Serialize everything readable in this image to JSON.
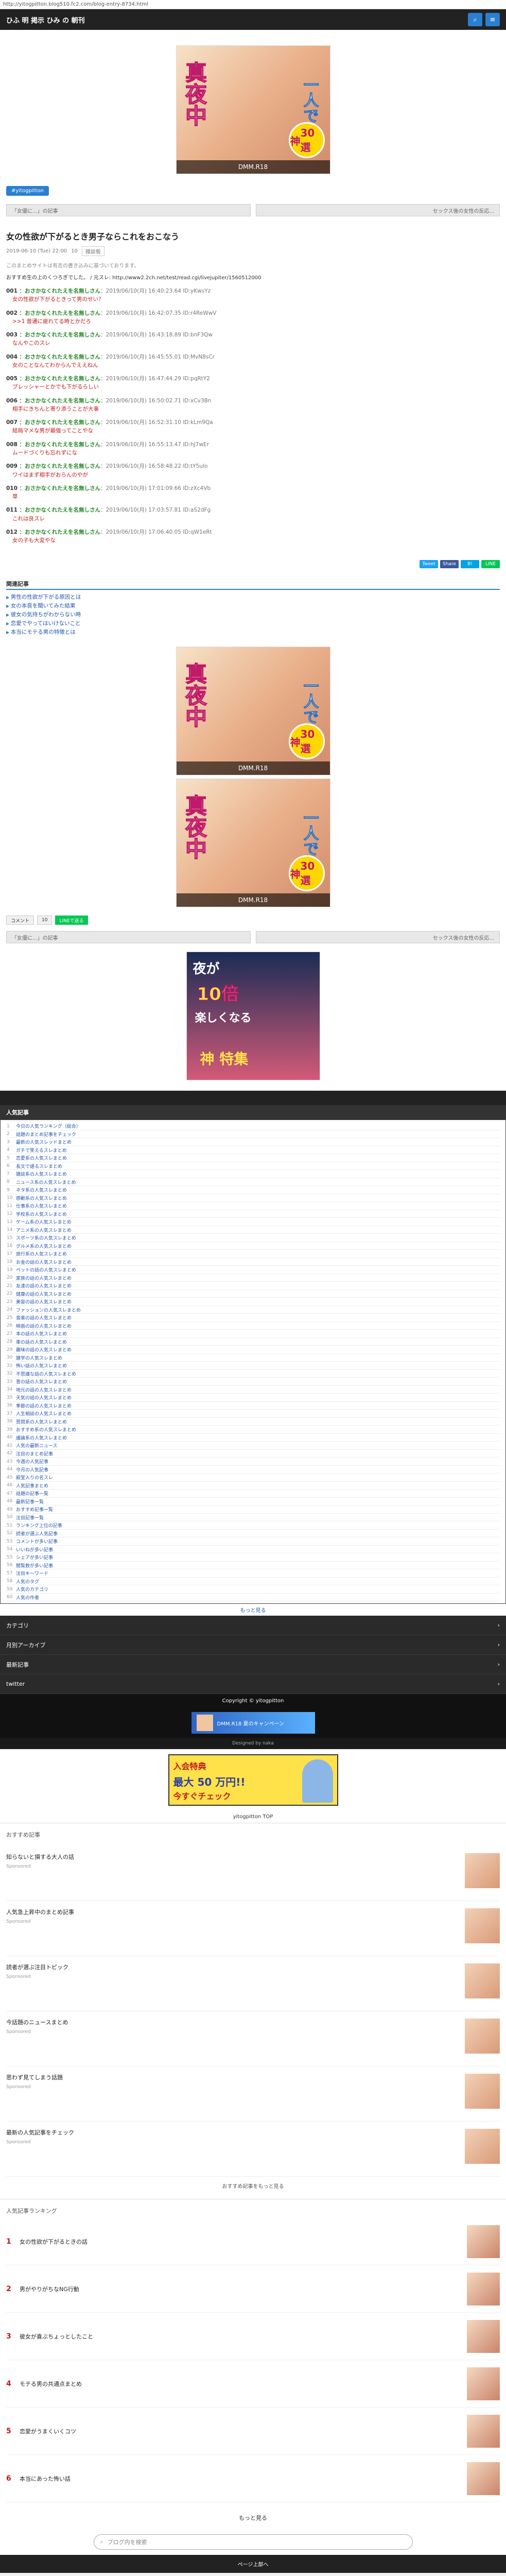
{
  "browser": {
    "url": "http://yitogpitton.blog510.fc2.com/blog-entry-8734.html"
  },
  "header": {
    "site_name": "ひふ 明 掲示  ひみ の 朝刊",
    "buttons": [
      "search-icon",
      "menu-icon"
    ]
  },
  "poster": {
    "line1": "真夜中",
    "line2": "一人で",
    "line3": "神",
    "badge": "30選",
    "brand": "DMM.R18"
  },
  "tag": "#yitogpitton",
  "nav": {
    "prev": "「女優に...」の記事",
    "next": "セックス後の女性の反応..."
  },
  "article": {
    "title": "女の性欲が下がるとき男子ならこれをおこなう",
    "date": "2019-06-10 (Tue) 22:00",
    "comments_count": "10",
    "category": "雑談板",
    "subnote": "このまとめサイトは有志の書き込みに基づいております。",
    "source": "おすすめ生の上のくつろぎでした。 / 元スレ: http://www2.2ch.net/test/read.cgi/livejupiter/1560512000",
    "posts": [
      {
        "num": "001",
        "name": "：おさかなくれたえを名無しさん",
        "date": "：2019/06/10(月) 16:40:23.64 ID:yKwsYz",
        "body": "女の性欲が下がるときって男のせい？"
      },
      {
        "num": "002",
        "name": "：おさかなくれたえを名無しさん",
        "date": "：2019/06/10(月) 16:42:07.35 ID:r4ReWwV",
        "body": ">>1 普通に疲れてる時とかだろ"
      },
      {
        "num": "003",
        "name": "：おさかなくれたえを名無しさん",
        "date": "：2019/06/10(月) 16:43:18.89 ID:bnF3Qw",
        "body": "なんやこのスレ"
      },
      {
        "num": "004",
        "name": "：おさかなくれたえを名無しさん",
        "date": "：2019/06/10(月) 16:45:55.01 ID:MvN8sCr",
        "body": "女のことなんてわからんでええねん"
      },
      {
        "num": "005",
        "name": "：おさかなくれたえを名無しさん",
        "date": "：2019/06/10(月) 16:47:44.29 ID:pqRtY2",
        "body": "プレッシャーとかでも下がるらしい"
      },
      {
        "num": "006",
        "name": "：おさかなくれたえを名無しさん",
        "date": "：2019/06/10(月) 16:50:02.71 ID:xCv3Bn",
        "body": "相手にきちんと寄り添うことが大事"
      },
      {
        "num": "007",
        "name": "：おさかなくれたえを名無しさん",
        "date": "：2019/06/10(月) 16:52:31.10 ID:kLm9Qa",
        "body": "結局マメな男が最強ってことやな"
      },
      {
        "num": "008",
        "name": "：おさかなくれたえを名無しさん",
        "date": "：2019/06/10(月) 16:55:13.47 ID:hJ7wEr",
        "body": "ムードづくりも忘れずにな"
      },
      {
        "num": "009",
        "name": "：おさかなくれたえを名無しさん",
        "date": "：2019/06/10(月) 16:58:48.22 ID:tY5uIo",
        "body": "ワイはまず相手がおらんのやが"
      },
      {
        "num": "010",
        "name": "：おさかなくれたえを名無しさん",
        "date": "：2019/06/10(月) 17:01:09.66 ID:zXc4Vb",
        "body": "草"
      },
      {
        "num": "011",
        "name": "：おさかなくれたえを名無しさん",
        "date": "：2019/06/10(月) 17:03:57.81 ID:aS2dFg",
        "body": "これは良スレ"
      },
      {
        "num": "012",
        "name": "：おさかなくれたえを名無しさん",
        "date": "：2019/06/10(月) 17:06:40.05 ID:qW1eRt",
        "body": "女の子も大変やな"
      }
    ]
  },
  "share": [
    {
      "label": "Tweet",
      "color": "#1da1f2"
    },
    {
      "label": "Share",
      "color": "#3b5998"
    },
    {
      "label": "B!",
      "color": "#00a4de"
    },
    {
      "label": "LINE",
      "color": "#06c755"
    }
  ],
  "related": {
    "heading": "関連記事",
    "items": [
      "男性の性欲が下がる原因とは",
      "女の本音を聞いてみた結果",
      "彼女の気持ちがわからない時",
      "恋愛でやってはいけないこと",
      "本当にモテる男の特徴とは"
    ]
  },
  "actions": {
    "comment": "コメント",
    "count": "10",
    "line": "LINEで送る"
  },
  "poster2": {
    "l1": "夜が",
    "l2": "10倍",
    "l3": "楽しくなる",
    "l4": "神 特集"
  },
  "comments": {
    "heading": "人気記事",
    "rows": [
      "今日の人気ランキング（総合）",
      "話題のまとめ記事をチェック",
      "最新の人気スレッドまとめ",
      "ガチで笑えるスレまとめ",
      "恋愛系の人気スレまとめ",
      "長文で語るスレまとめ",
      "雑談系の人気スレまとめ",
      "ニュース系の人気スレまとめ",
      "ネタ系の人気スレまとめ",
      "感動系の人気スレまとめ",
      "仕事系の人気スレまとめ",
      "学校系の人気スレまとめ",
      "ゲーム系の人気スレまとめ",
      "アニメ系の人気スレまとめ",
      "スポーツ系の人気スレまとめ",
      "グルメ系の人気スレまとめ",
      "旅行系の人気スレまとめ",
      "お金の話の人気スレまとめ",
      "ペットの話の人気スレまとめ",
      "家族の話の人気スレまとめ",
      "友達の話の人気スレまとめ",
      "健康の話の人気スレまとめ",
      "美容の話の人気スレまとめ",
      "ファッションの人気スレまとめ",
      "音楽の話の人気スレまとめ",
      "映画の話の人気スレまとめ",
      "本の話の人気スレまとめ",
      "車の話の人気スレまとめ",
      "趣味の話の人気スレまとめ",
      "雑学の人気スレまとめ",
      "怖い話の人気スレまとめ",
      "不思議な話の人気スレまとめ",
      "昔の話の人気スレまとめ",
      "地元の話の人気スレまとめ",
      "天気の話の人気スレまとめ",
      "季節の話の人気スレまとめ",
      "人生相談の人気スレまとめ",
      "質問系の人気スレまとめ",
      "おすすめ系の人気スレまとめ",
      "議論系の人気スレまとめ",
      "人気の最新ニュース",
      "注目のまとめ記事",
      "今週の人気記事",
      "今月の人気記事",
      "殿堂入りの名スレ",
      "人気記事まとめ",
      "話題の記事一覧",
      "最新記事一覧",
      "おすすめ記事一覧",
      "注目記事一覧",
      "ランキング上位の記事",
      "読者が選ぶ人気記事",
      "コメントが多い記事",
      "いいねが多い記事",
      "シェアが多い記事",
      "閲覧数が多い記事",
      "注目キーワード",
      "人気のタグ",
      "人気のカテゴリ",
      "人気の作者"
    ],
    "more": "もっと見る"
  },
  "side_menu": [
    "カテゴリ",
    "月別アーカイブ",
    "最新記事",
    "twitter"
  ],
  "copyright": "Copyright © yitogpitton",
  "banner": "DMM.R18 夏のキャンペーン",
  "footnote": "Designed by naka",
  "footnote2": "yitogpitton TOP",
  "yellowad": {
    "y1": "入会特典",
    "y2": "最大 50 万円!!",
    "y3": "今すぐチェック"
  },
  "recbox": {
    "heading": "おすすめ記事",
    "items": [
      {
        "title": "知らないと損する大人の話",
        "src": "Sponsored"
      },
      {
        "title": "人気急上昇中のまとめ記事",
        "src": "Sponsored"
      },
      {
        "title": "読者が選ぶ注目トピック",
        "src": "Sponsored"
      },
      {
        "title": "今話題のニュースまとめ",
        "src": "Sponsored"
      },
      {
        "title": "思わず見てしまう話題",
        "src": "Sponsored"
      },
      {
        "title": "最新の人気記事をチェック",
        "src": "Sponsored"
      }
    ],
    "footer": "おすすめ記事をもっと見る"
  },
  "ranking": {
    "heading": "人気記事ランキング",
    "items": [
      {
        "rank": "1",
        "title": "女の性欲が下がるときの話"
      },
      {
        "rank": "2",
        "title": "男がやりがちなNG行動"
      },
      {
        "rank": "3",
        "title": "彼女が喜ぶちょっとしたこと"
      },
      {
        "rank": "4",
        "title": "モテる男の共通点まとめ"
      },
      {
        "rank": "5",
        "title": "恋愛がうまくいくコツ"
      },
      {
        "rank": "6",
        "title": "本当にあった怖い話"
      }
    ]
  },
  "more_btn": "もっと見る",
  "search_placeholder": "ブログ内を検索",
  "endfoot": "ページ上部へ"
}
